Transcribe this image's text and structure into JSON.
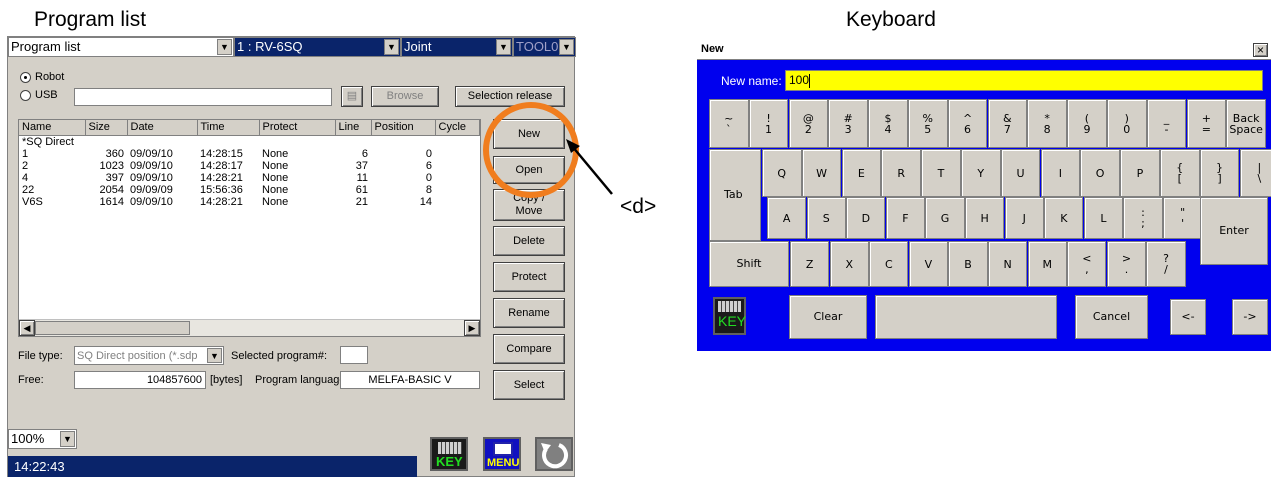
{
  "captions": {
    "left": "Program list",
    "right": "Keyboard",
    "marker": "<d>"
  },
  "program_list": {
    "view_select": "Program list",
    "robot_select": "1 : RV-6SQ",
    "jog_select": "Joint",
    "tool_select": "TOOL0",
    "source": {
      "robot_label": "Robot",
      "usb_label": "USB",
      "selected": "Robot"
    },
    "browse_label": "Browse",
    "selection_release_label": "Selection release",
    "columns": [
      "Name",
      "Size",
      "Date",
      "Time",
      "Protect",
      "Line",
      "Position",
      "Cycle"
    ],
    "rows": [
      {
        "name": "*SQ Direct",
        "size": "",
        "date": "",
        "time": "",
        "protect": "",
        "line": "",
        "position": ""
      },
      {
        "name": "1",
        "size": "360",
        "date": "09/09/10",
        "time": "14:28:15",
        "protect": "None",
        "line": "6",
        "position": "0"
      },
      {
        "name": "2",
        "size": "1023",
        "date": "09/09/10",
        "time": "14:28:17",
        "protect": "None",
        "line": "37",
        "position": "6"
      },
      {
        "name": "4",
        "size": "397",
        "date": "09/09/10",
        "time": "14:28:21",
        "protect": "None",
        "line": "11",
        "position": "0"
      },
      {
        "name": "22",
        "size": "2054",
        "date": "09/09/09",
        "time": "15:56:36",
        "protect": "None",
        "line": "61",
        "position": "8"
      },
      {
        "name": "V6S",
        "size": "1614",
        "date": "09/09/10",
        "time": "14:28:21",
        "protect": "None",
        "line": "21",
        "position": "14"
      }
    ],
    "buttons": {
      "new": "New",
      "open": "Open",
      "copy_move": "Copy /\nMove",
      "delete": "Delete",
      "protect": "Protect",
      "rename": "Rename",
      "compare": "Compare",
      "select": "Select"
    },
    "file_type_label": "File type:",
    "file_type_value": "SQ Direct position (*.sdp",
    "selected_program_label": "Selected program#:",
    "free_label": "Free:",
    "free_value": "104857600",
    "free_unit": "[bytes]",
    "language_label": "Program language:",
    "language_value": "MELFA-BASIC V",
    "zoom": "100%",
    "clock": "14:22:43",
    "key_icon_label": "KEY",
    "menu_icon_label": "MENU"
  },
  "keyboard": {
    "title": "New",
    "close": "×",
    "new_name_label": "New name:",
    "new_name_value": "100",
    "row1": [
      "~\n`",
      "!\n1",
      "@\n2",
      "#\n3",
      "$\n4",
      "%\n5",
      "^\n6",
      "&\n7",
      "*\n8",
      "(\n9",
      ")\n0",
      "_\n-",
      "+\n=",
      "Back\nSpace"
    ],
    "row2": [
      "Q",
      "W",
      "E",
      "R",
      "T",
      "Y",
      "U",
      "I",
      "O",
      "P",
      "{\n[",
      "}\n]",
      "|\n\\"
    ],
    "row3": [
      "A",
      "S",
      "D",
      "F",
      "G",
      "H",
      "J",
      "K",
      "L",
      ":\n;",
      "\"\n'"
    ],
    "row4": [
      "Z",
      "X",
      "C",
      "V",
      "B",
      "N",
      "M",
      "<\n,",
      ">\n.",
      "?\n/"
    ],
    "tab": "Tab",
    "enter": "Enter",
    "shift": "Shift",
    "clear": "Clear",
    "cancel": "Cancel",
    "left": "<-",
    "right": "->",
    "key_label": "KEY"
  },
  "colors": {
    "accent_orange": "#f07d1e",
    "title_blue": "#0a246a",
    "keyboard_blue": "#0000ee",
    "input_yellow": "#ffff00"
  }
}
